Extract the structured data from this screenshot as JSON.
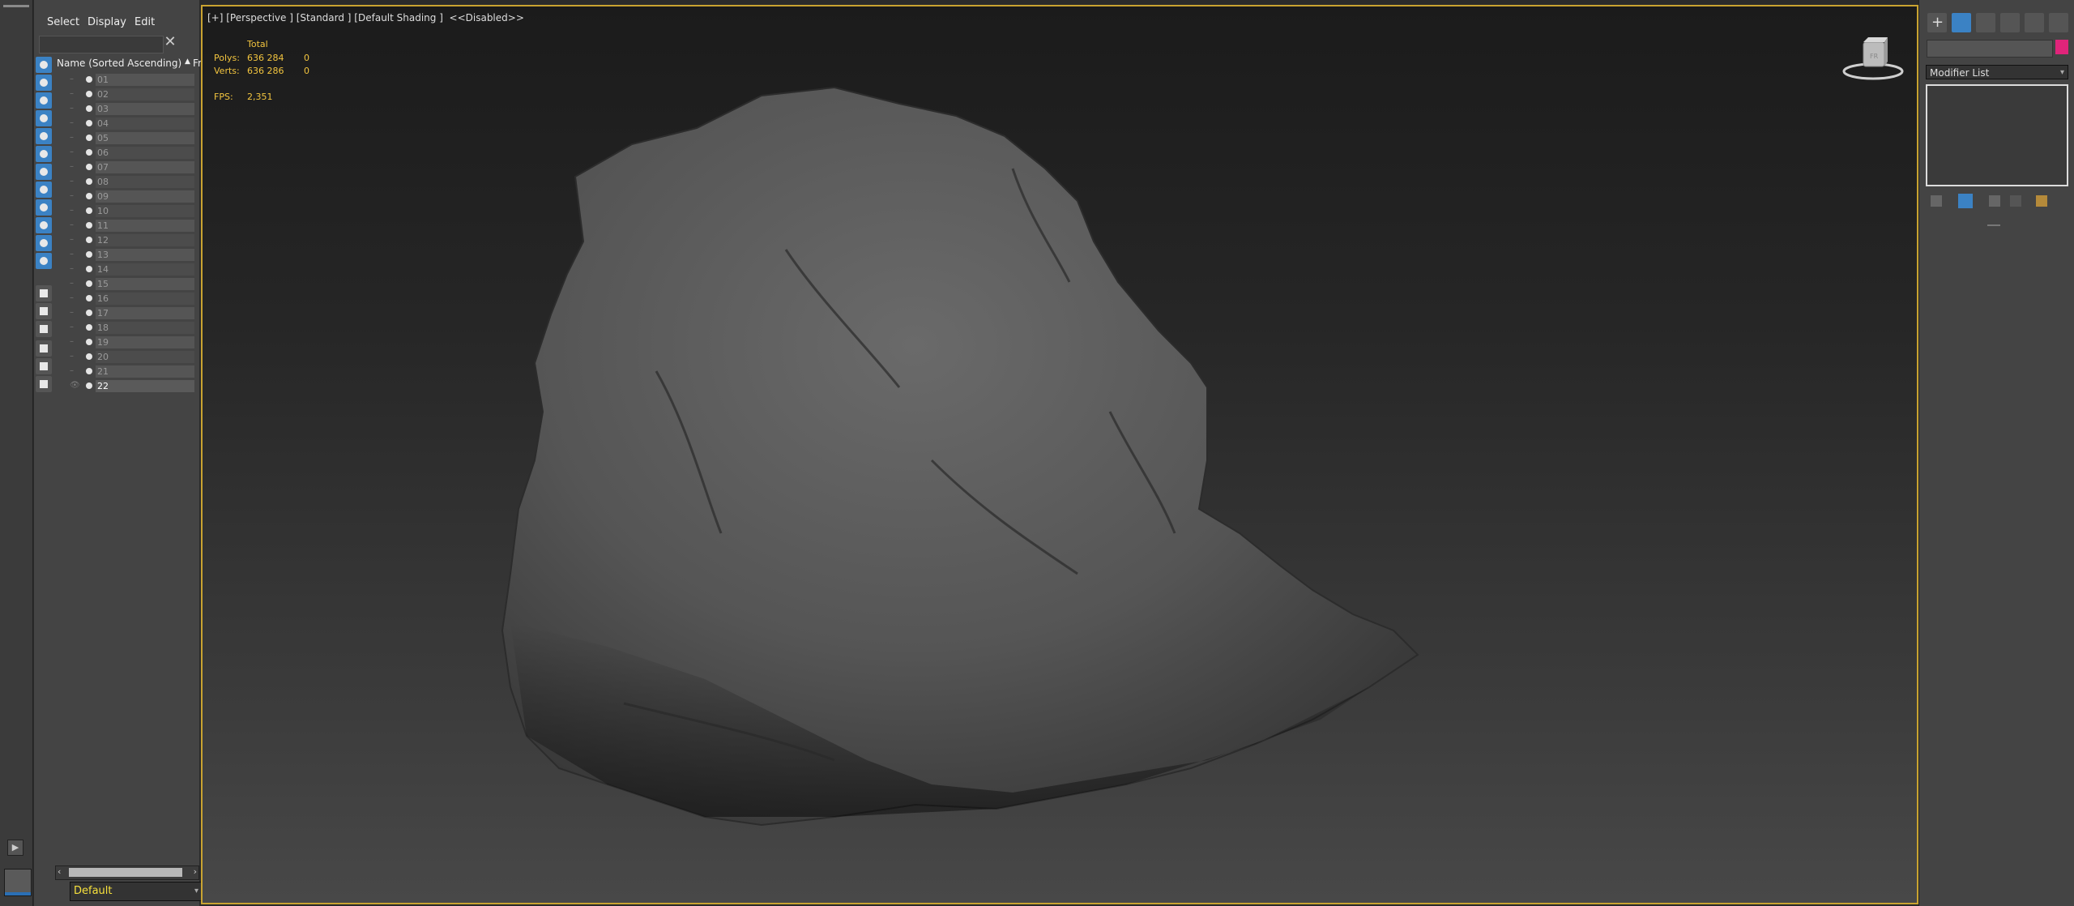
{
  "explorer": {
    "menu": [
      "Select",
      "Display",
      "Edit"
    ],
    "search_value": "",
    "column_name": "Name (Sorted Ascending)",
    "column_sort": "▲",
    "column_frozen": "Froze",
    "layers": [
      "01",
      "02",
      "03",
      "04",
      "05",
      "06",
      "07",
      "08",
      "09",
      "10",
      "11",
      "12",
      "13",
      "14",
      "15",
      "16",
      "17",
      "18",
      "19",
      "20",
      "21",
      "22"
    ],
    "selected_layer": "22",
    "current_layer": "Default"
  },
  "viewport": {
    "label": "[+] [Perspective ] [Standard ] [Default Shading ]  <<Disabled>>",
    "stats": {
      "total_label": "Total",
      "polys_label": "Polys:",
      "polys_value": "636 284",
      "polys_sel": "0",
      "verts_label": "Verts:",
      "verts_value": "636 286",
      "verts_sel": "0",
      "fps_label": "FPS:",
      "fps_value": "2,351"
    },
    "viewcube_label": "FR"
  },
  "command_panel": {
    "object_name": "",
    "object_color": "#e0247a",
    "modifier_list_label": "Modifier List"
  },
  "colors": {
    "viewport_border": "#c9a331",
    "accent_blue": "#3b82c4",
    "stats_yellow": "#f3c53f"
  }
}
